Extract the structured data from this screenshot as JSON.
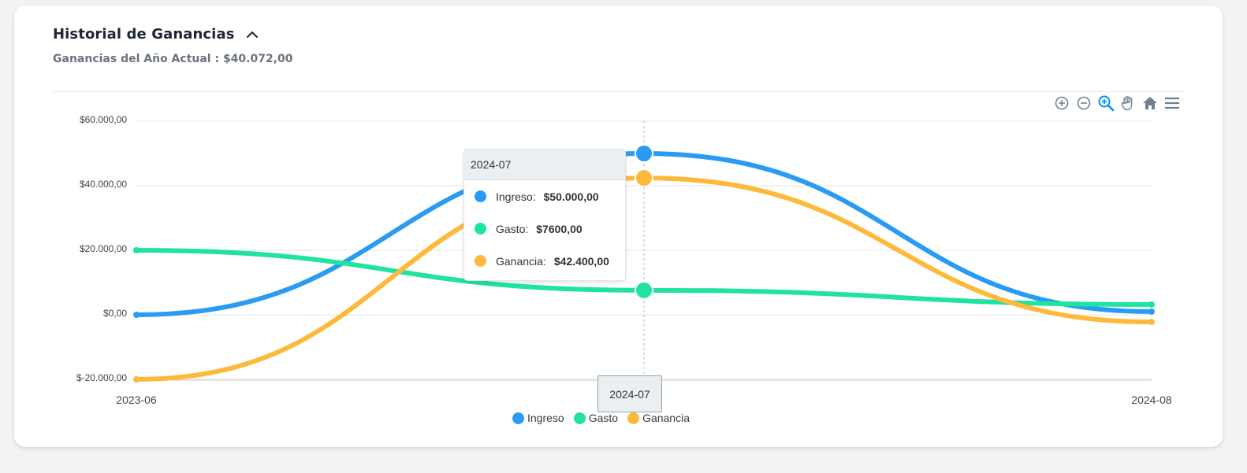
{
  "header": {
    "title": "Historial de Ganancias",
    "subtitle": "Ganancias del Año Actual : $40.072,00"
  },
  "toolbar": {
    "icons": [
      "zoom-in-icon",
      "zoom-out-icon",
      "selection-zoom-icon",
      "pan-hand-icon",
      "reset-home-icon",
      "menu-icon"
    ],
    "active": "selection-zoom-icon"
  },
  "colors": {
    "ingreso": "#2a9bf4",
    "gasto": "#1fe39e",
    "ganancia": "#fdb93a",
    "grid": "#e6e6e6",
    "toolbar_icon": "#6e8192",
    "toolbar_active": "#008ffb"
  },
  "chart_data": {
    "type": "line",
    "x": [
      "2023-06",
      "2024-07",
      "2024-08"
    ],
    "x_tick_labels": [
      "2023-06",
      "2024-08"
    ],
    "y_ticks": [
      "$60.000,00",
      "$40.000,00",
      "$20.000,00",
      "$0,00",
      "$-20.000,00"
    ],
    "ylim": [
      -20000,
      60000
    ],
    "series": [
      {
        "name": "Ingreso",
        "values": [
          0,
          50000,
          1000
        ]
      },
      {
        "name": "Gasto",
        "values": [
          20000,
          7600,
          3200
        ]
      },
      {
        "name": "Ganancia",
        "values": [
          -20000,
          42400,
          -2200
        ]
      }
    ],
    "grid": true,
    "legend_position": "bottom",
    "curve": "smooth"
  },
  "tooltip": {
    "title": "2024-07",
    "rows": [
      {
        "label": "Ingreso:",
        "value": "$50.000,00"
      },
      {
        "label": "Gasto:",
        "value": "$7600,00"
      },
      {
        "label": "Ganancia:",
        "value": "$42.400,00"
      }
    ]
  },
  "crosshair_label": "2024-07",
  "legend": [
    "Ingreso",
    "Gasto",
    "Ganancia"
  ]
}
